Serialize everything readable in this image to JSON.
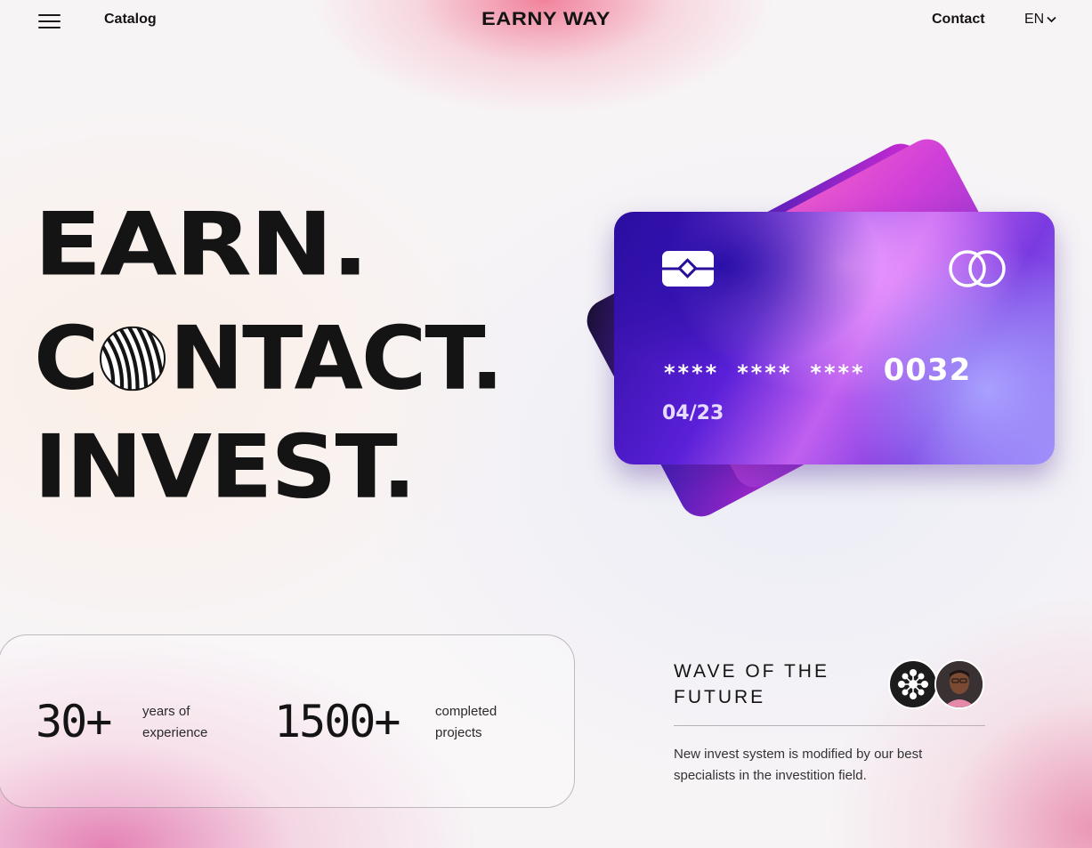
{
  "header": {
    "menu_icon": "hamburger-icon",
    "catalog_label": "Catalog",
    "logo": "EARNY WAY",
    "contact_label": "Contact",
    "language": "EN",
    "language_icon": "chevron-down-icon"
  },
  "hero": {
    "line1": "EARN.",
    "line2_prefix": "C",
    "line2_suffix": "NTACT.",
    "line2_icon": "striped-globe-icon",
    "line3": "INVEST."
  },
  "card": {
    "masked_groups": [
      "****",
      "****",
      "****"
    ],
    "last_digits": "0032",
    "expiry": "04/23",
    "chip_icon": "card-chip-icon",
    "brand_icon": "mastercard-icon"
  },
  "stats": [
    {
      "value": "30+",
      "label": "years of experience"
    },
    {
      "value": "1500+",
      "label": "completed projects"
    }
  ],
  "wave": {
    "title": "WAVE OF THE FUTURE",
    "description": "New invest system is modified by our best specialists in the investition field.",
    "avatars": [
      "network-icon",
      "person-avatar"
    ]
  }
}
